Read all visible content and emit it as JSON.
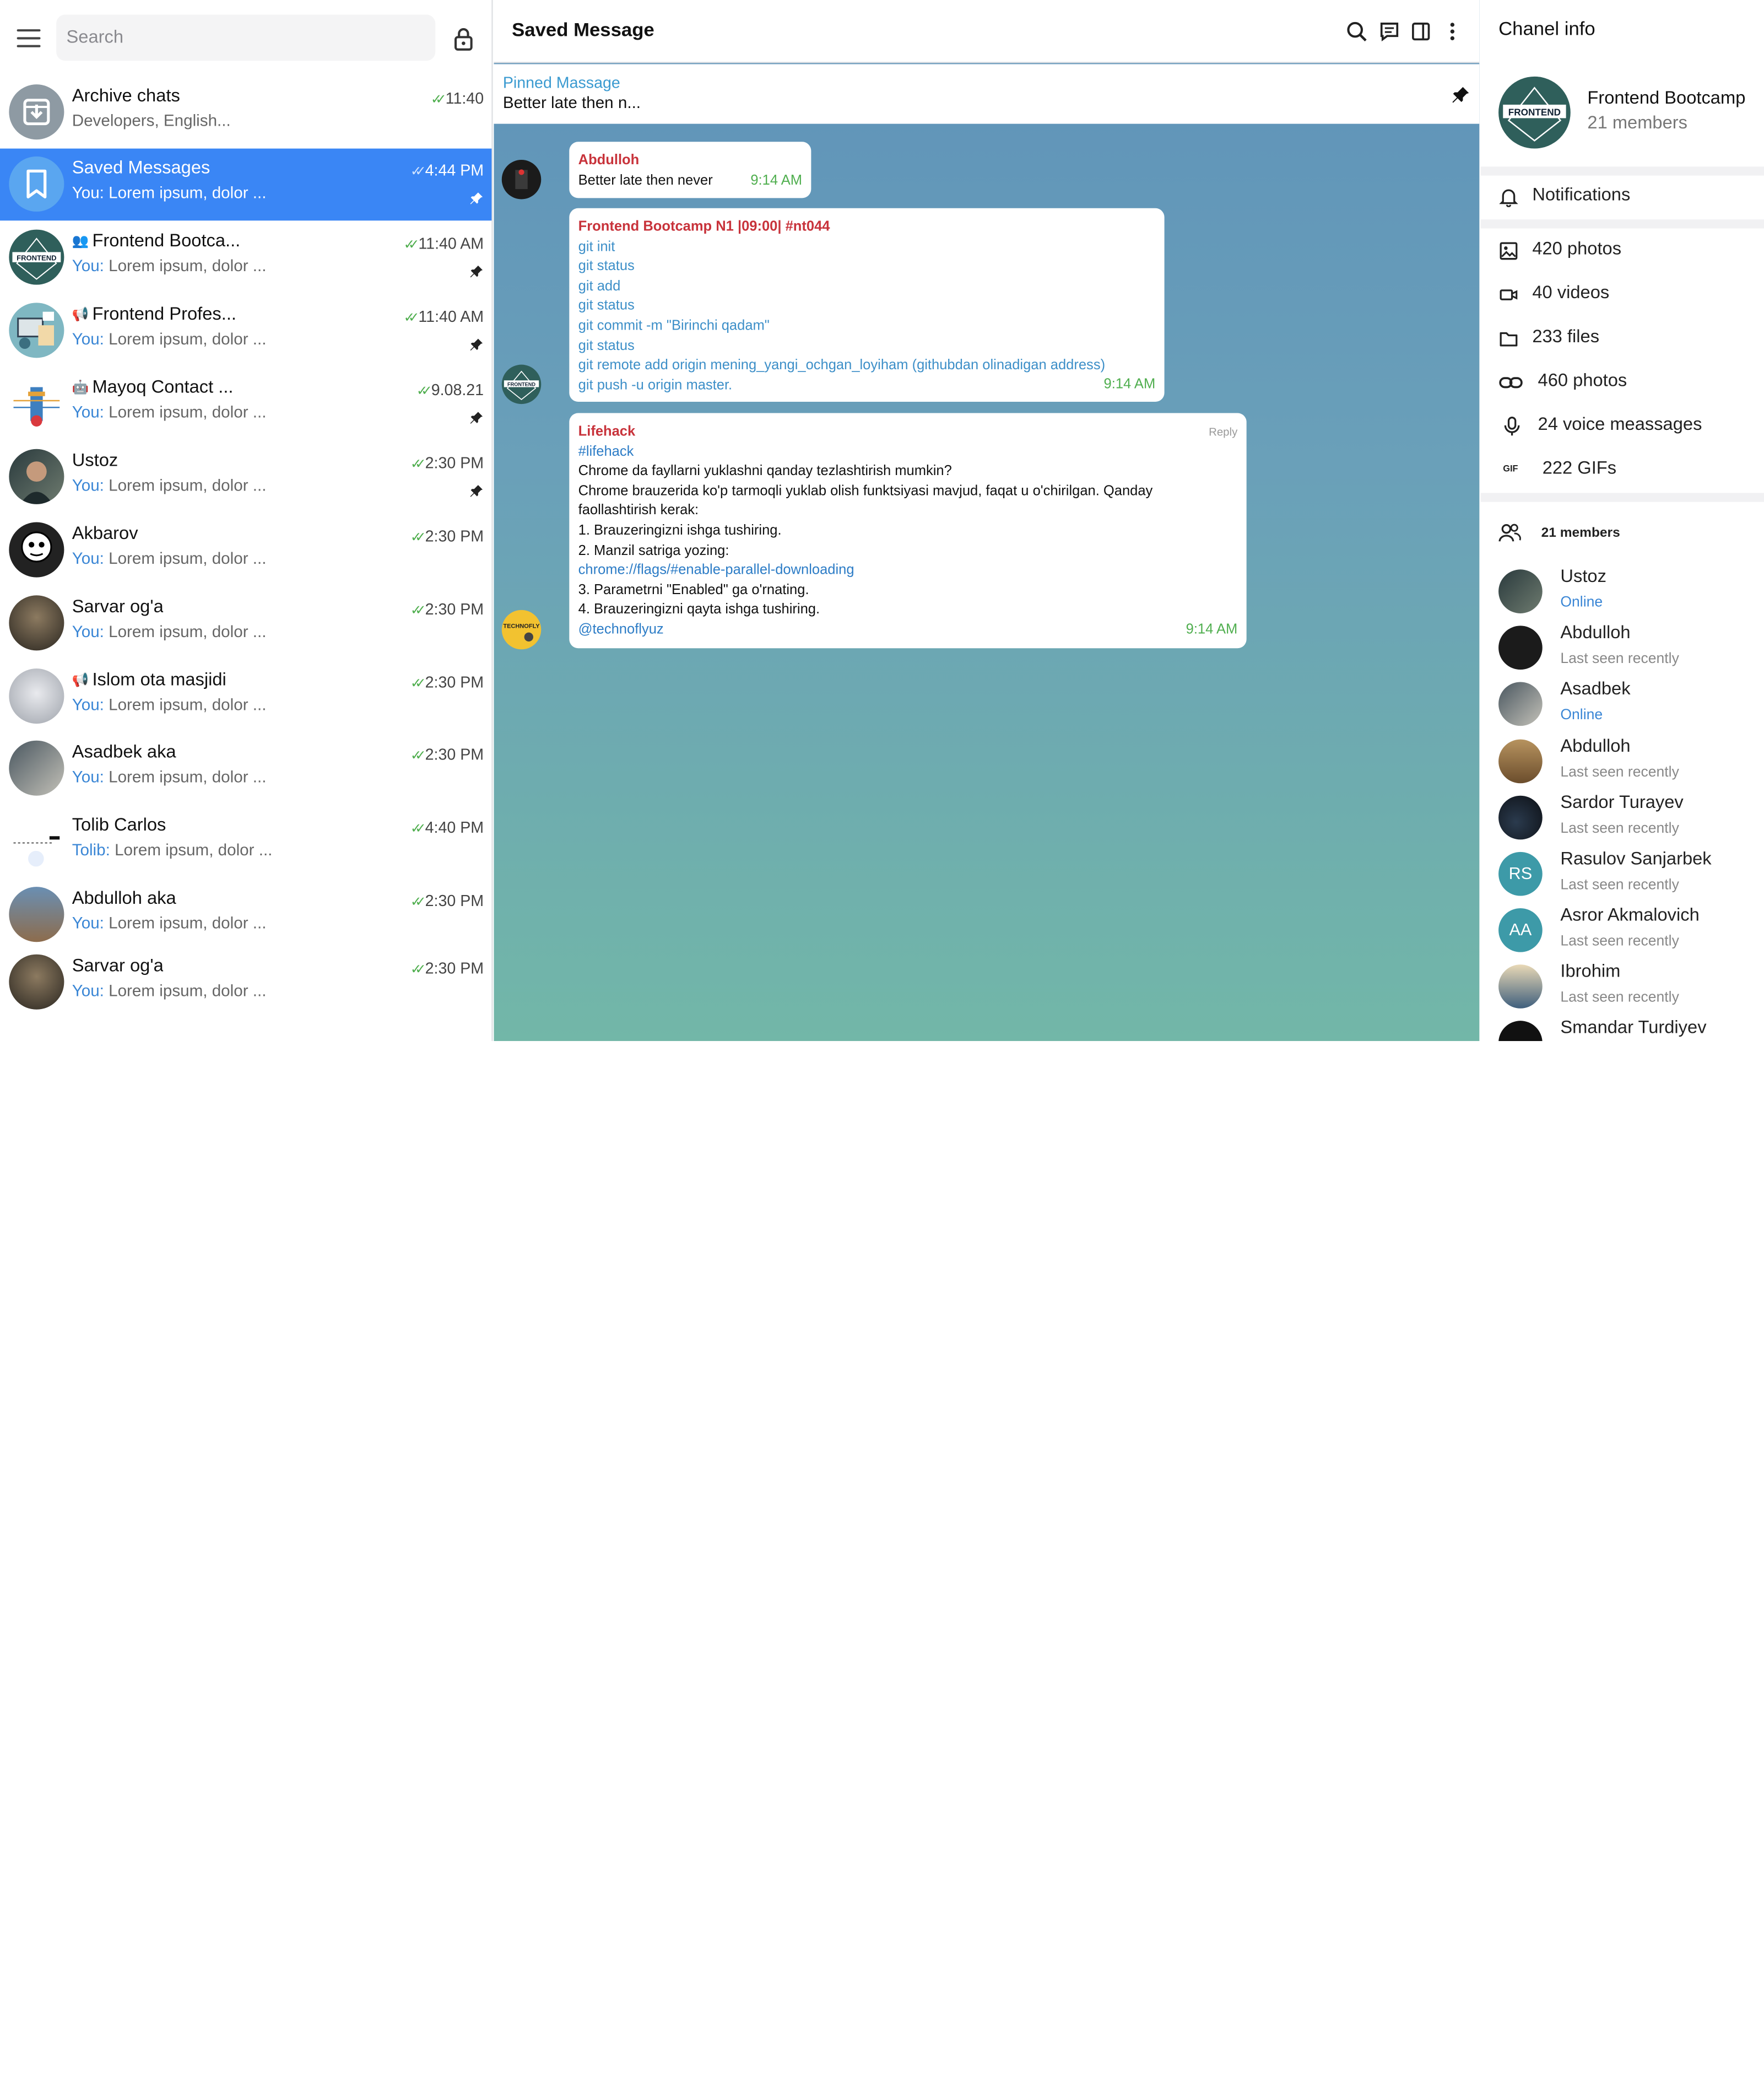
{
  "sidebar": {
    "search_placeholder": "Search",
    "chats": [
      {
        "name": "Archive chats",
        "preview_who": "",
        "preview_text": "Developers, English...",
        "time": "11:40",
        "pinned": false,
        "kind": ""
      },
      {
        "name": "Saved Messages",
        "preview_who": "You:",
        "preview_text": " Lorem ipsum, dolor ...",
        "time": "4:44 PM",
        "pinned": true,
        "kind": ""
      },
      {
        "name": "Frontend Bootca...",
        "preview_who": "You:",
        "preview_text": " Lorem ipsum, dolor ...",
        "time": "11:40 AM",
        "pinned": true,
        "kind": "group"
      },
      {
        "name": "Frontend Profes...",
        "preview_who": "You:",
        "preview_text": " Lorem ipsum, dolor ...",
        "time": "11:40 AM",
        "pinned": true,
        "kind": "channel"
      },
      {
        "name": "Mayoq Contact ...",
        "preview_who": "You:",
        "preview_text": " Lorem ipsum, dolor ...",
        "time": "9.08.21",
        "pinned": true,
        "kind": "bot"
      },
      {
        "name": "Ustoz",
        "preview_who": "You:",
        "preview_text": " Lorem ipsum, dolor ...",
        "time": "2:30 PM",
        "pinned": true,
        "kind": ""
      },
      {
        "name": "Akbarov",
        "preview_who": "You:",
        "preview_text": " Lorem ipsum, dolor ...",
        "time": "2:30 PM",
        "pinned": false,
        "kind": ""
      },
      {
        "name": "Sarvar og'a",
        "preview_who": "You:",
        "preview_text": " Lorem ipsum, dolor ...",
        "time": "2:30 PM",
        "pinned": false,
        "kind": ""
      },
      {
        "name": "Islom ota masjidi",
        "preview_who": "You:",
        "preview_text": " Lorem ipsum, dolor ...",
        "time": "2:30 PM",
        "pinned": false,
        "kind": "channel"
      },
      {
        "name": "Asadbek aka",
        "preview_who": "You:",
        "preview_text": " Lorem ipsum, dolor ...",
        "time": "2:30 PM",
        "pinned": false,
        "kind": ""
      },
      {
        "name": "Tolib Carlos",
        "preview_who": "Tolib:",
        "preview_text": " Lorem ipsum, dolor ...",
        "time": "4:40 PM",
        "pinned": false,
        "kind": ""
      },
      {
        "name": "Abdulloh aka",
        "preview_who": "You:",
        "preview_text": " Lorem ipsum, dolor ...",
        "time": "2:30 PM",
        "pinned": false,
        "kind": ""
      },
      {
        "name": "Sarvar og'a",
        "preview_who": "You:",
        "preview_text": " Lorem ipsum, dolor ...",
        "time": "2:30 PM",
        "pinned": false,
        "kind": ""
      }
    ]
  },
  "main": {
    "title": "Saved Message",
    "pinned_label": "Pinned Massage",
    "pinned_text": "Better late then n...",
    "messages": [
      {
        "sender": "Abdulloh",
        "lines": [
          "Better late then never"
        ],
        "time": "9:14 AM"
      },
      {
        "sender": "Frontend Bootcamp N1 |09:00| #nt044",
        "lines": [
          "git init",
          "git status",
          "git add",
          "git status",
          "git commit -m \"Birinchi qadam\"",
          "git status",
          "git remote add origin mening_yangi_ochgan_loyiham (githubdan olinadigan address)",
          "git push -u origin master."
        ],
        "time": "9:14 AM"
      },
      {
        "sender": "Lifehack",
        "reply": "Reply",
        "lines": [
          "#lifehack",
          "Chrome da fayllarni yuklashni qanday tezlashtirish mumkin?",
          "Chrome brauzerida ko'p tarmoqli yuklab olish funktsiyasi mavjud, faqat u o'chirilgan. Qanday",
          "faollashtirish kerak:",
          "1. Brauzeringizni ishga tushiring.",
          "2. Manzil satriga yozing:",
          "chrome://flags/#enable-parallel-downloading",
          "3. Parametrni \"Enabled\" ga o'rnating.",
          "4. Brauzeringizni qayta ishga tushiring.",
          "@technoflyuz"
        ],
        "time": "9:14 AM",
        "avatar_text": "TECHNOFLY"
      }
    ]
  },
  "info": {
    "title": "Chanel info",
    "channel_name": "Frontend Bootcamp",
    "channel_members": "21 members",
    "logo_text": "FRONTEND",
    "notifications": "Notifications",
    "media": [
      "420 photos",
      "40 videos",
      "233 files",
      "460 photos",
      "24 voice meassages",
      "222 GIFs"
    ],
    "gif_icon_text": "GIF",
    "members_header": "21 members",
    "members": [
      {
        "name": "Ustoz",
        "status": "Online",
        "online": true,
        "initials": ""
      },
      {
        "name": "Abdulloh",
        "status": "Last seen recently",
        "online": false,
        "initials": ""
      },
      {
        "name": "Asadbek",
        "status": "Online",
        "online": true,
        "initials": ""
      },
      {
        "name": "Abdulloh",
        "status": "Last seen recently",
        "online": false,
        "initials": ""
      },
      {
        "name": "Sardor Turayev",
        "status": "Last seen recently",
        "online": false,
        "initials": ""
      },
      {
        "name": "Rasulov Sanjarbek",
        "status": "Last seen recently",
        "online": false,
        "initials": "RS"
      },
      {
        "name": "Asror Akmalovich",
        "status": "Last seen recently",
        "online": false,
        "initials": "AA"
      },
      {
        "name": "Ibrohim",
        "status": "Last seen recently",
        "online": false,
        "initials": ""
      },
      {
        "name": "Smandar Turdiyev",
        "status": "",
        "online": false,
        "initials": ""
      }
    ]
  },
  "colors": {
    "accent": "#3a86f5",
    "sender": "#c8333b",
    "check": "#4fae4e",
    "avatar_teal": "#3d9aa8"
  }
}
